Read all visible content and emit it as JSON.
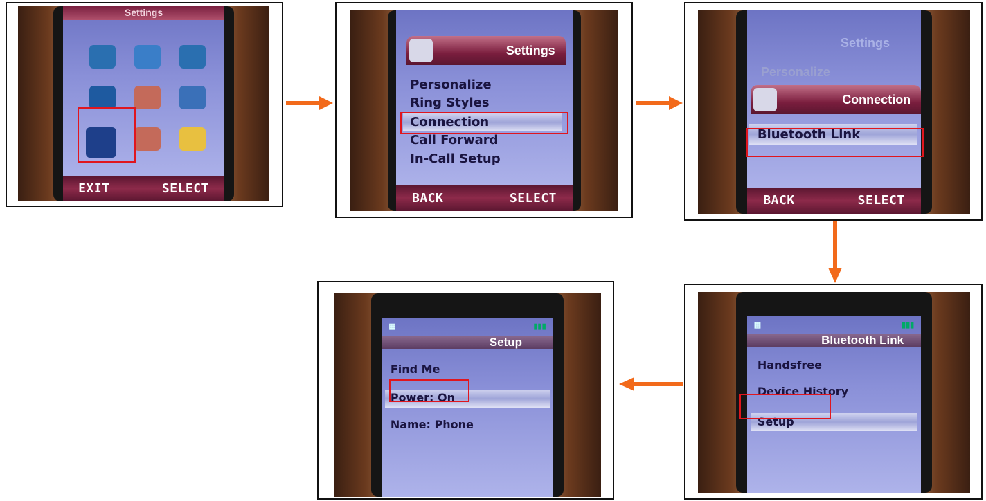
{
  "step1": {
    "title": "Settings",
    "left_key": "EXIT",
    "right_key": "SELECT"
  },
  "step2": {
    "title": "Settings",
    "items": [
      "Personalize",
      "Ring Styles",
      "Connection",
      "Call Forward",
      "In-Call Setup"
    ],
    "left_key": "BACK",
    "right_key": "SELECT"
  },
  "step3": {
    "back_title": "Settings",
    "back_item": "Personalize",
    "title": "Connection",
    "item": "Bluetooth Link",
    "left_key": "BACK",
    "right_key": "SELECT"
  },
  "step4": {
    "title": "Bluetooth Link",
    "items": [
      "Handsfree",
      "Device History",
      "Setup"
    ]
  },
  "step5": {
    "title": "Setup",
    "items": [
      "Find Me",
      "Power: On",
      "Name: Phone"
    ]
  },
  "colors": {
    "arrow": "#f26a1b",
    "highlight": "#e0161e"
  }
}
